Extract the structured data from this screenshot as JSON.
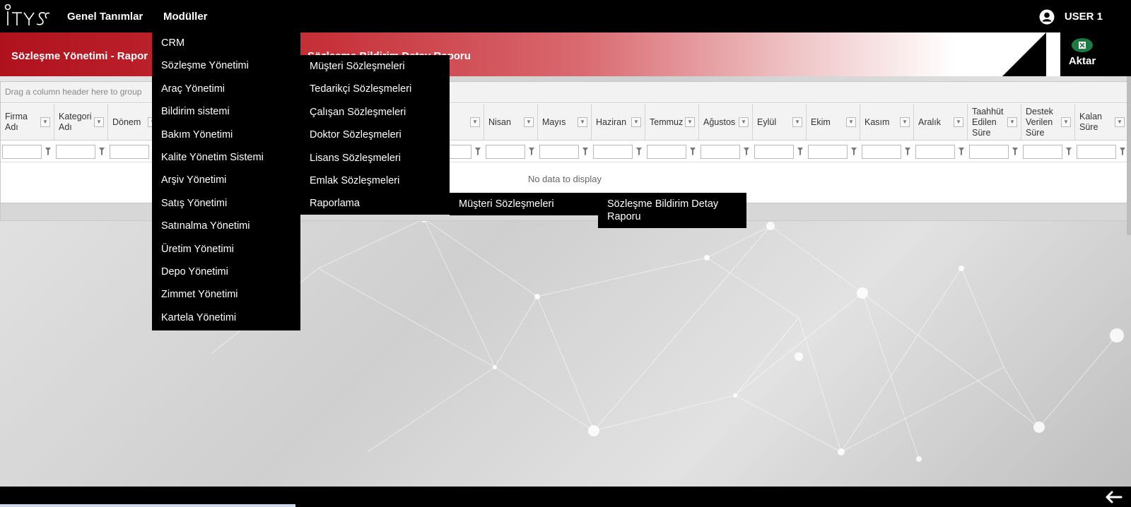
{
  "topbar": {
    "logo": "ITYS",
    "nav": [
      "Genel Tanımlar",
      "Modüller"
    ],
    "user": "USER 1"
  },
  "title": {
    "left": "Sözleşme Yönetimi - Rapor",
    "right": "Sözleşme Bildirim Detay Raporu",
    "export_label": "Aktar"
  },
  "grid": {
    "group_hint": "Drag a column header here to group",
    "no_data": "No data to display",
    "columns": [
      "Firma Adı",
      "Kategori Adı",
      "Dönem",
      "",
      "",
      "",
      "",
      "",
      "t",
      "Nisan",
      "Mayıs",
      "Haziran",
      "Temmuz",
      "Ağustos",
      "Eylül",
      "Ekim",
      "Kasım",
      "Aralık",
      "Taahhüt Edilen Süre",
      "Destek Verilen Süre",
      "Kalan Süre"
    ]
  },
  "menus": {
    "modules": [
      "CRM",
      "Sözleşme Yönetimi",
      "Araç Yönetimi",
      "Bildirim sistemi",
      "Bakım Yönetimi",
      "Kalite Yönetim Sistemi",
      "Arşiv Yönetimi",
      "Satış Yönetimi",
      "Satınalma Yönetimi",
      "Üretim Yönetimi",
      "Depo Yönetimi",
      "Zimmet Yönetimi",
      "Kartela Yönetimi"
    ],
    "contracts": [
      "Müşteri Sözleşmeleri",
      "Tedarikçi Sözleşmeleri",
      "Çalışan Sözleşmeleri",
      "Doktor Sözleşmeleri",
      "Lisans Sözleşmeleri",
      "Emlak Sözleşmeleri",
      "Raporlama"
    ],
    "reporting": [
      "Müşteri Sözleşmeleri"
    ],
    "reports": [
      "Sözleşme Bildirim Detay Raporu"
    ]
  },
  "colors": {
    "brand_red": "#b0121d",
    "menu_bg": "#000000",
    "excel_green": "#1e7a43"
  }
}
